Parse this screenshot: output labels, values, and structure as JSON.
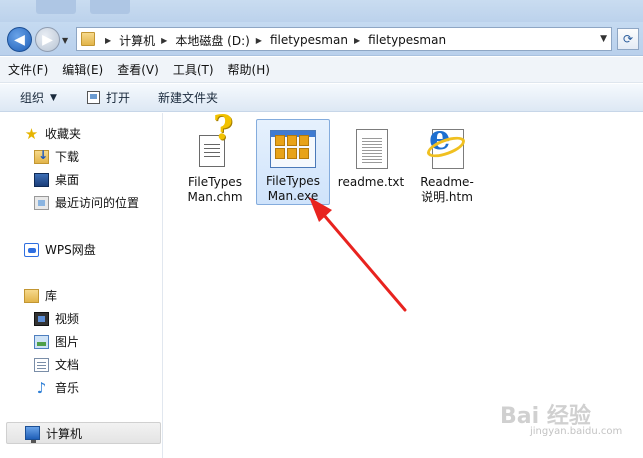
{
  "address": {
    "crumbs": [
      "计算机",
      "本地磁盘 (D:)",
      "filetypesman",
      "filetypesman"
    ]
  },
  "menu": [
    "文件(F)",
    "编辑(E)",
    "查看(V)",
    "工具(T)",
    "帮助(H)"
  ],
  "toolbar": {
    "organize": "组织",
    "open": "打开",
    "new_folder": "新建文件夹"
  },
  "sidebar": {
    "favorites": "收藏夹",
    "downloads": "下载",
    "desktop": "桌面",
    "recent": "最近访问的位置",
    "wps": "WPS网盘",
    "libraries": "库",
    "videos": "视频",
    "pictures": "图片",
    "documents": "文档",
    "music": "音乐",
    "computer": "计算机"
  },
  "files": [
    {
      "line1": "FileTypes",
      "line2": "Man.chm",
      "type": "chm-icon"
    },
    {
      "line1": "FileTypes",
      "line2": "Man.exe",
      "type": "exe-icon"
    },
    {
      "line1": "readme.txt",
      "line2": "",
      "type": "txt-icon"
    },
    {
      "line1": "Readme-",
      "line2": "说明.htm",
      "type": "ie-htm-icon"
    }
  ],
  "watermark": {
    "main": "Bai 经验",
    "url": "jingyan.baidu.com"
  },
  "colors": {
    "arrow": "#e8231f",
    "selection": "#cfe3fb"
  }
}
